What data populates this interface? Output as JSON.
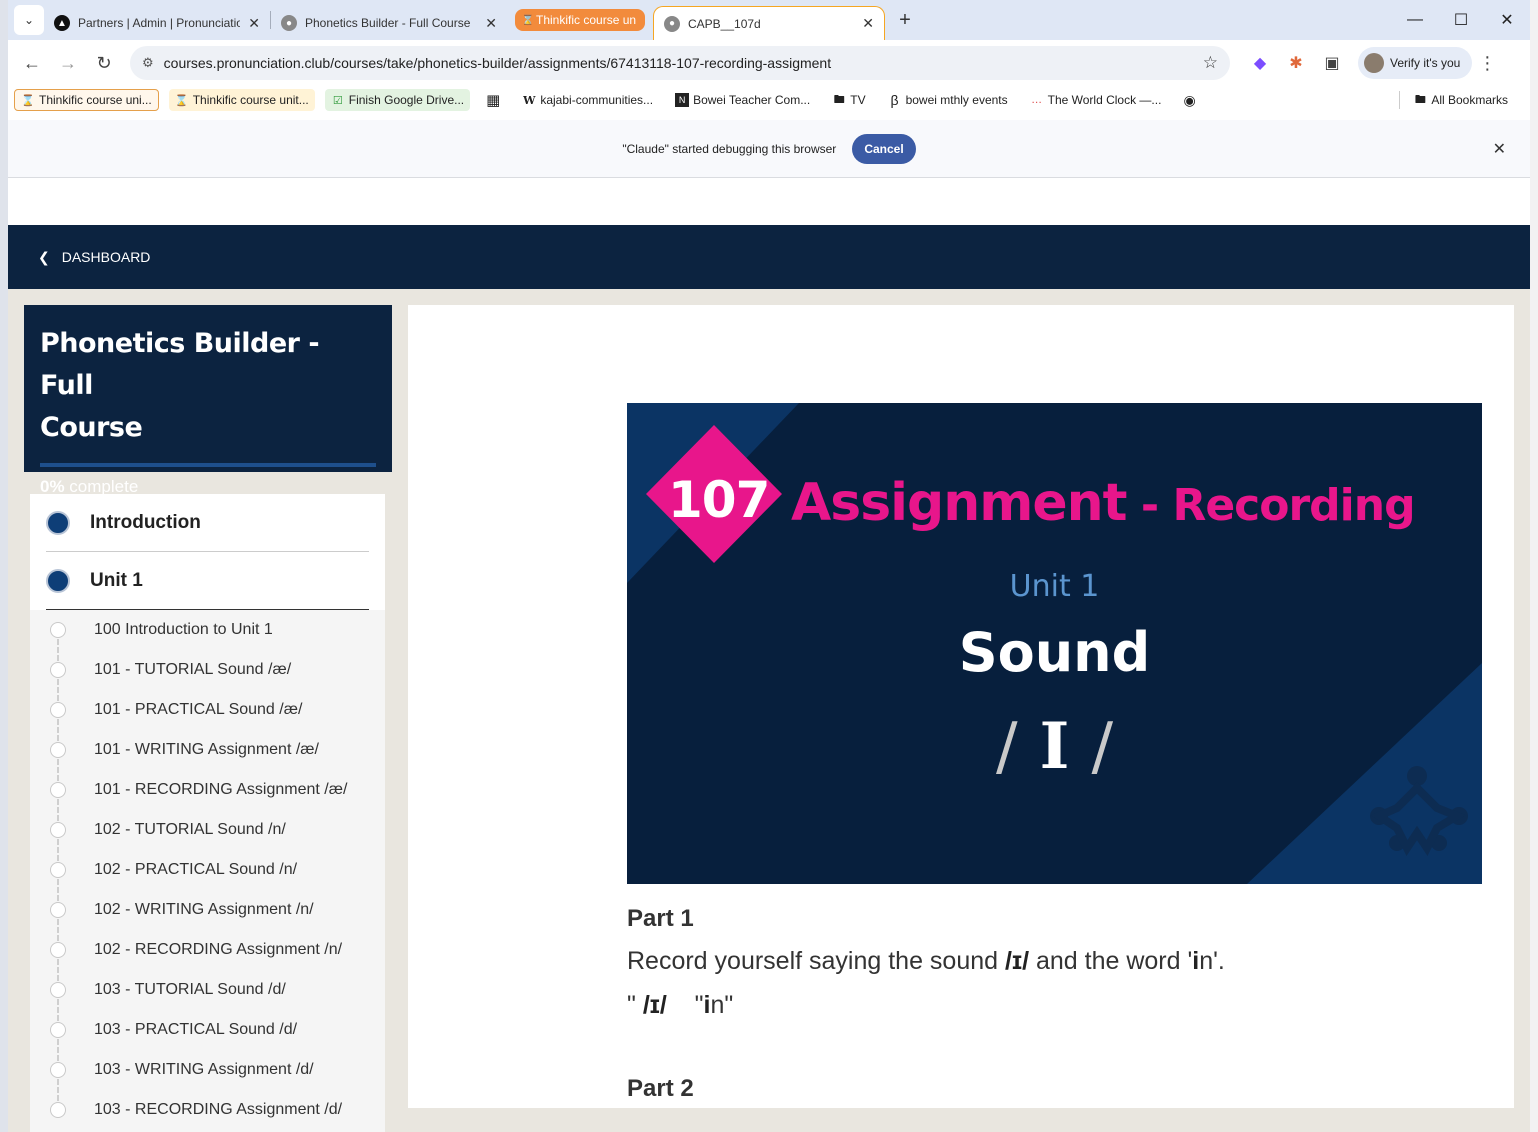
{
  "browser": {
    "tabs": [
      {
        "title": "Partners | Admin | Pronunciation",
        "favicon": "triangle-icon"
      },
      {
        "title": "Phonetics Builder - Full Course",
        "favicon": "globe-icon"
      },
      {
        "title": "Thinkific course un",
        "favicon": "hourglass-icon"
      },
      {
        "title": "CAPB__107d",
        "favicon": "globe-icon"
      }
    ],
    "url": "courses.pronunciation.club/courses/take/phonetics-builder/assignments/67413118-107-recording-assigment",
    "verify_label": "Verify it's you",
    "bookmarks": [
      {
        "label": "Thinkific course uni...",
        "icon": "hourglass-icon"
      },
      {
        "label": "Thinkific course unit...",
        "icon": "hourglass-icon"
      },
      {
        "label": "Finish Google Drive...",
        "icon": "checkbox-icon"
      },
      {
        "label": "kajabi-communities...",
        "icon": "wiki-icon"
      },
      {
        "label": "Bowei Teacher Com...",
        "icon": "notion-icon"
      },
      {
        "label": "TV",
        "icon": "folder-icon"
      },
      {
        "label": "bowei mthly events",
        "icon": "beta-icon"
      },
      {
        "label": "The World Clock —...",
        "icon": "clock-icon"
      }
    ],
    "all_bookmarks": "All Bookmarks",
    "debug_message": "\"Claude\" started debugging this browser",
    "debug_cancel": "Cancel"
  },
  "nav": {
    "dashboard": "DASHBOARD"
  },
  "course": {
    "title_line1": "Phonetics Builder - Full",
    "title_line2": "Course",
    "progress_percent": "0%",
    "progress_suffix": " complete",
    "progress_value": 0
  },
  "chapters": [
    {
      "label": "Introduction"
    },
    {
      "label": "Unit 1"
    }
  ],
  "lessons": [
    "100 Introduction to Unit 1",
    "101 - TUTORIAL Sound /æ/",
    "101 - PRACTICAL Sound /æ/",
    "101 - WRITING Assignment /æ/",
    "101 - RECORDING Assignment /æ/",
    "102 - TUTORIAL Sound /n/",
    "102 - PRACTICAL Sound /n/",
    "102 - WRITING Assignment /n/",
    "102 - RECORDING Assignment /n/",
    "103 - TUTORIAL Sound /d/",
    "103 - PRACTICAL Sound /d/",
    "103 - WRITING Assignment /d/",
    "103 - RECORDING Assignment /d/"
  ],
  "banner": {
    "number": "107",
    "title_main": "Assignment",
    "title_sep": " - ",
    "title_sub": "Recording",
    "unit": "Unit 1",
    "sound_label": "Sound",
    "ipa_char": "I",
    "slash": "/",
    "colors": {
      "background": "#071f3d",
      "accent": "#e8168b",
      "unit": "#5b95cf"
    }
  },
  "parts": {
    "part1_heading": "Part 1",
    "part1_pre": "Record yourself saying the sound ",
    "part1_ipa": "/ɪ/",
    "part1_mid": " and the word '",
    "part1_word_bold": "i",
    "part1_word_rest": "n'.",
    "part1_example_open": "\" ",
    "part1_example_ipa": "/ɪ/",
    "part1_example_gap": "    \"",
    "part1_example_bold": "i",
    "part1_example_rest": "n\"",
    "part2_heading": "Part 2"
  }
}
